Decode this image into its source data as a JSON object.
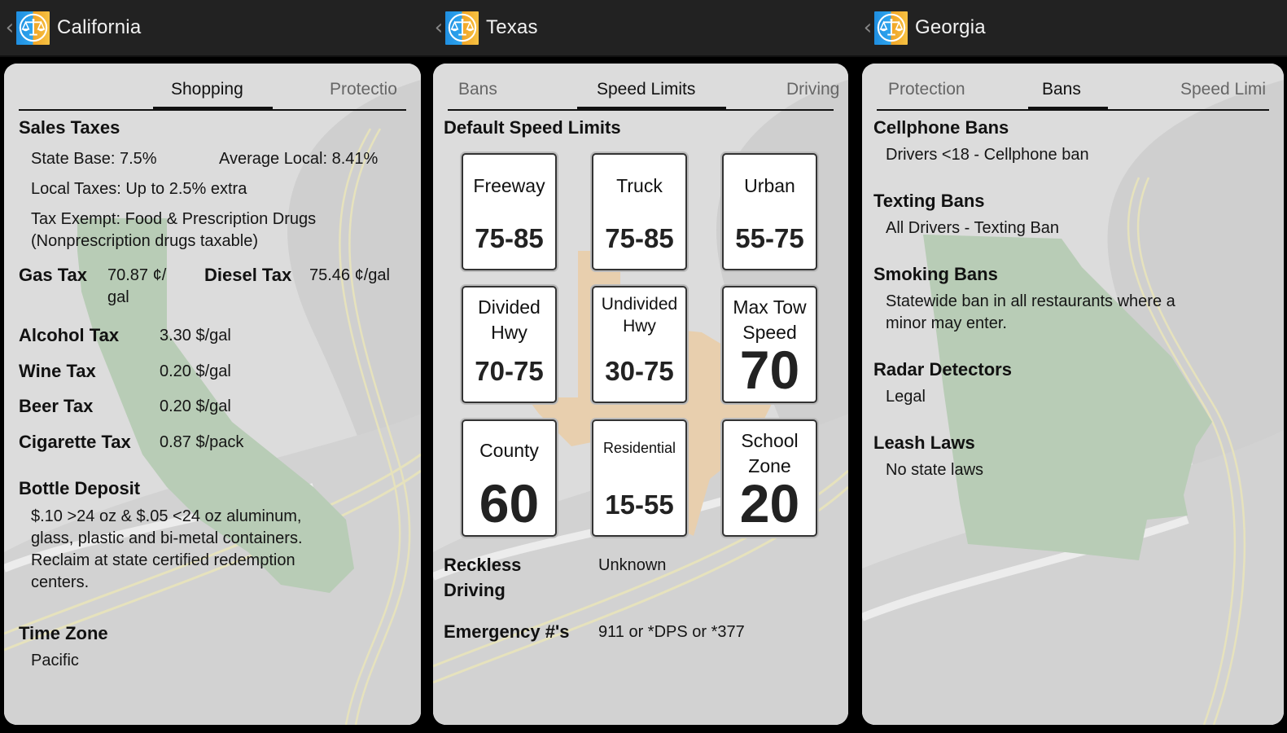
{
  "colors": {
    "actionbar_bg": "#222222",
    "panel_bg": "#dcdcdc",
    "california_map": "#b8ccb6",
    "texas_map": "#e8cfae",
    "georgia_map": "#b8ccb6",
    "road_line": "#e6e2bd"
  },
  "screens": [
    {
      "title": "California",
      "icon": "scales-of-justice-icon",
      "tabs": [
        {
          "label": "",
          "active": false
        },
        {
          "label": "Shopping",
          "active": true
        },
        {
          "label": "Protectio",
          "active": false
        }
      ],
      "sales_taxes": {
        "heading": "Sales Taxes",
        "state_base": "State Base: 7.5%",
        "average_local": "Average Local: 8.41%",
        "local_taxes": "Local Taxes: Up to 2.5% extra",
        "tax_exempt_1": "Tax Exempt: Food & Prescription Drugs",
        "tax_exempt_2": "(Nonprescription drugs taxable)"
      },
      "gas_tax": {
        "label": "Gas Tax",
        "value_1": "70.87 ¢/",
        "value_2": "gal"
      },
      "diesel_tax": {
        "label": "Diesel Tax",
        "value": "75.46 ¢/gal"
      },
      "rows": [
        {
          "label": "Alcohol Tax",
          "value": "3.30 $/gal"
        },
        {
          "label": "Wine Tax",
          "value": "0.20 $/gal"
        },
        {
          "label": "Beer Tax",
          "value": "0.20 $/gal"
        },
        {
          "label": "Cigarette Tax",
          "value": "0.87 $/pack"
        }
      ],
      "bottle_deposit": {
        "heading": "Bottle Deposit",
        "lines": [
          "$.10 >24 oz & $.05 <24 oz aluminum,",
          "glass, plastic and bi-metal containers.",
          "Reclaim at state certified redemption",
          "centers."
        ]
      },
      "time_zone": {
        "heading": "Time Zone",
        "value": "Pacific"
      }
    },
    {
      "title": "Texas",
      "icon": "scales-of-justice-icon",
      "tabs": [
        {
          "label": "Bans",
          "active": false
        },
        {
          "label": "Speed Limits",
          "active": true
        },
        {
          "label": "Driving",
          "active": false
        }
      ],
      "section_heading": "Default Speed Limits",
      "signs": [
        {
          "label": "Freeway",
          "value": "75-85"
        },
        {
          "label": "Truck",
          "value": "75-85"
        },
        {
          "label": "Urban",
          "value": "55-75"
        },
        {
          "label_1": "Divided",
          "label_2": "Hwy",
          "value": "70-75"
        },
        {
          "label_1": "Undivided",
          "label_2": "Hwy",
          "value": "30-75"
        },
        {
          "label_1": "Max Tow",
          "label_2": "Speed",
          "value": "70"
        },
        {
          "label": "County",
          "value": "60"
        },
        {
          "label": "Residential",
          "value": "15-55"
        },
        {
          "label_1": "School",
          "label_2": "Zone",
          "value": "20"
        }
      ],
      "reckless": {
        "label_1": "Reckless",
        "label_2": "Driving",
        "value": "Unknown"
      },
      "emergency": {
        "label": "Emergency #'s",
        "value": "911 or *DPS or *377"
      }
    },
    {
      "title": "Georgia",
      "icon": "scales-of-justice-icon",
      "tabs": [
        {
          "label": "Protection",
          "active": false
        },
        {
          "label": "Bans",
          "active": true
        },
        {
          "label": "Speed Limi",
          "active": false
        }
      ],
      "sections": [
        {
          "heading": "Cellphone Bans",
          "value": "Drivers <18 - Cellphone ban"
        },
        {
          "heading": "Texting Bans",
          "value": "All Drivers - Texting Ban"
        },
        {
          "heading": "Smoking Bans",
          "value_1": "Statewide ban in all restaurants where a",
          "value_2": "minor may enter."
        },
        {
          "heading": "Radar Detectors",
          "value": "Legal"
        },
        {
          "heading": "Leash Laws",
          "value": "No state laws"
        }
      ]
    }
  ]
}
